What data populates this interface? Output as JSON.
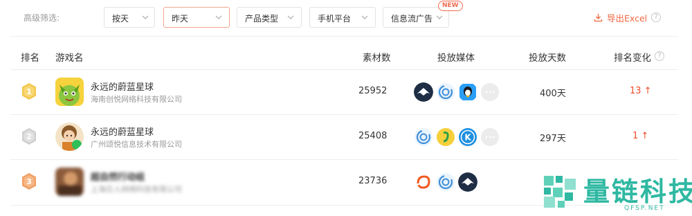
{
  "filters": {
    "label": "高级筛选:",
    "dropdowns": [
      {
        "label": "按天"
      },
      {
        "label": "昨天"
      },
      {
        "label": "产品类型"
      },
      {
        "label": "手机平台"
      },
      {
        "label": "信息流广告"
      }
    ],
    "new_badge": "NEW",
    "export_label": "导出Excel",
    "accent_color": "#f0673f"
  },
  "table": {
    "headers": {
      "rank": "排名",
      "game": "游戏名",
      "count": "素材数",
      "media": "投放媒体",
      "days": "投放天数",
      "change": "排名变化"
    },
    "rows": [
      {
        "rank": "1",
        "badge_color": "#f3c74f",
        "game_name": "永远的蔚蓝星球",
        "company": "海南创悦网络科技有限公司",
        "material_count": "25952",
        "media_icons": [
          "eagle-media-icon",
          "swirl-media-icon",
          "penguin-media-icon",
          "more-media-icon"
        ],
        "days": "400天",
        "rank_change": "13 ↑"
      },
      {
        "rank": "2",
        "badge_color": "#c9c9c9",
        "game_name": "永远的蔚蓝星球",
        "company": "广州颂悦信息技术有限公司",
        "material_count": "25408",
        "media_icons": [
          "swirl-media-icon",
          "green-note-media-icon",
          "k-media-icon",
          "more-media-icon"
        ],
        "days": "297天",
        "rank_change": "1 ↑"
      },
      {
        "rank": "3",
        "badge_color": "#f3a56b",
        "game_name": "超自然行动组",
        "company": "上海巨人网络科技有限公司",
        "material_count": "23736",
        "media_icons": [
          "orange-swirl-media-icon",
          "swirl-media-icon",
          "eagle-media-icon"
        ],
        "days": "",
        "rank_change": ""
      }
    ]
  },
  "watermark": {
    "brand": "量链科技",
    "domain": "QFSP.NET"
  }
}
